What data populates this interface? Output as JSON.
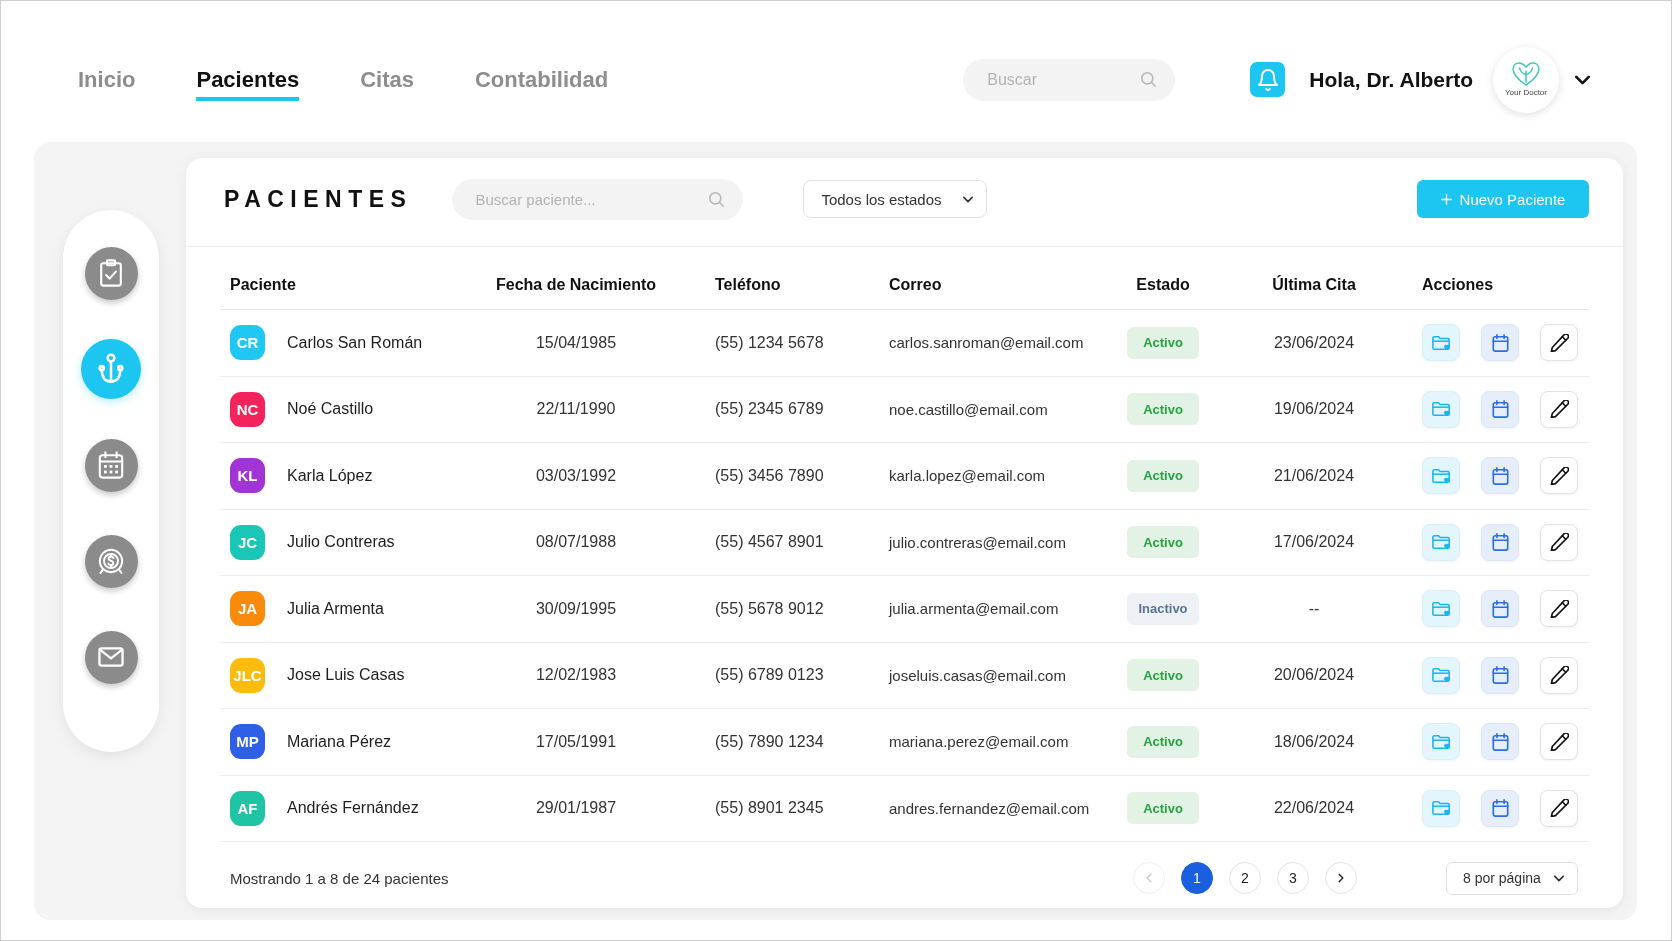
{
  "nav": {
    "tabs": [
      {
        "label": "Inicio",
        "selected": false
      },
      {
        "label": "Pacientes",
        "selected": true
      },
      {
        "label": "Citas",
        "selected": false
      },
      {
        "label": "Contabilidad",
        "selected": false
      }
    ],
    "search": {
      "placeholder": "Buscar"
    },
    "greeting": "Hola, Dr. Alberto",
    "logo": {
      "text": "Your Doctor"
    }
  },
  "sidebar": {
    "items": [
      {
        "kind": "clipboard",
        "selected": false
      },
      {
        "kind": "anchor",
        "selected": true
      },
      {
        "kind": "calendar",
        "selected": false
      },
      {
        "kind": "coin",
        "selected": false
      },
      {
        "kind": "mail",
        "selected": false
      }
    ]
  },
  "panel": {
    "title": "PACIENTES",
    "search": {
      "placeholder": "Buscar paciente..."
    },
    "filter": {
      "value": "Todos los estados"
    },
    "new_button": {
      "label": "Nuevo Paciente"
    }
  },
  "table": {
    "columns": [
      "Paciente",
      "Fecha de Nacimiento",
      "Teléfono",
      "Correo",
      "Estado",
      "Última Cita",
      "Acciones"
    ],
    "rows": [
      {
        "initials": "CR",
        "color": "#1ec8f2",
        "name": "Carlos San Román",
        "birth_date": "15/04/1985",
        "phone": "(55) 1234 5678",
        "email": "carlos.sanroman@email.com",
        "status": {
          "label": "Activo",
          "active": true
        },
        "last_visit": "23/06/2024"
      },
      {
        "initials": "NC",
        "color": "#f3245c",
        "name": "Noé Castillo",
        "birth_date": "22/11/1990",
        "phone": "(55) 2345 6789",
        "email": "noe.castillo@email.com",
        "status": {
          "label": "Activo",
          "active": true
        },
        "last_visit": "19/06/2024"
      },
      {
        "initials": "KL",
        "color": "#a034d4",
        "name": "Karla López",
        "birth_date": "03/03/1992",
        "phone": "(55) 3456 7890",
        "email": "karla.lopez@email.com",
        "status": {
          "label": "Activo",
          "active": true
        },
        "last_visit": "21/06/2024"
      },
      {
        "initials": "JC",
        "color": "#1ac6b6",
        "name": "Julio Contreras",
        "birth_date": "08/07/1988",
        "phone": "(55) 4567 8901",
        "email": "julio.contreras@email.com",
        "status": {
          "label": "Activo",
          "active": true
        },
        "last_visit": "17/06/2024"
      },
      {
        "initials": "JA",
        "color": "#f98a0a",
        "name": "Julia Armenta",
        "birth_date": "30/09/1995",
        "phone": "(55) 5678 9012",
        "email": "julia.armenta@email.com",
        "status": {
          "label": "Inactivo",
          "active": false
        },
        "last_visit": "--"
      },
      {
        "initials": "JLC",
        "color": "#fcbc0e",
        "name": "Jose Luis Casas",
        "birth_date": "12/02/1983",
        "phone": "(55) 6789 0123",
        "email": "joseluis.casas@email.com",
        "status": {
          "label": "Activo",
          "active": true
        },
        "last_visit": "20/06/2024"
      },
      {
        "initials": "MP",
        "color": "#2f5fe6",
        "name": "Mariana Pérez",
        "birth_date": "17/05/1991",
        "phone": "(55) 7890 1234",
        "email": "mariana.perez@email.com",
        "status": {
          "label": "Activo",
          "active": true
        },
        "last_visit": "18/06/2024"
      },
      {
        "initials": "AF",
        "color": "#1ec4a4",
        "name": "Andrés Fernández",
        "birth_date": "29/01/1987",
        "phone": "(55) 8901 2345",
        "email": "andres.fernandez@email.com",
        "status": {
          "label": "Activo",
          "active": true
        },
        "last_visit": "22/06/2024"
      }
    ]
  },
  "footer": {
    "summary": "Mostrando 1 a 8 de 24 pacientes",
    "pagination": {
      "prev": {
        "disabled": true
      },
      "pages": [
        {
          "label": "1",
          "selected": true
        },
        {
          "label": "2",
          "selected": false
        },
        {
          "label": "3",
          "selected": false
        }
      ],
      "next": {
        "disabled": false
      }
    },
    "page_size": "8 por página"
  }
}
